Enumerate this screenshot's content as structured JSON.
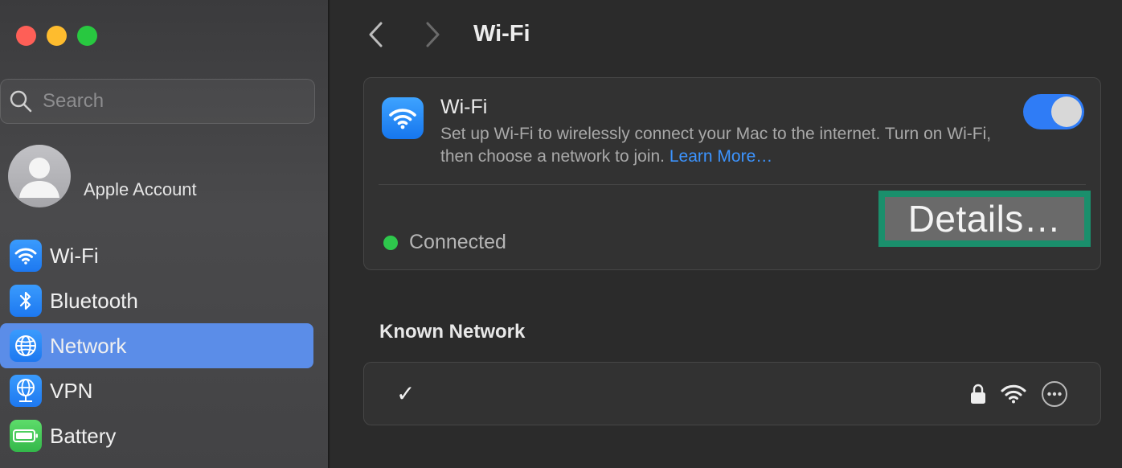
{
  "window": {
    "controls": [
      "close",
      "minimize",
      "zoom"
    ]
  },
  "sidebar": {
    "search": {
      "placeholder": "Search",
      "value": ""
    },
    "account": {
      "label": "Apple Account"
    },
    "items": [
      {
        "label": "Wi-Fi",
        "icon": "wifi-icon",
        "color": "#1d78f0",
        "active": false
      },
      {
        "label": "Bluetooth",
        "icon": "bluetooth-icon",
        "color": "#1d78f0",
        "active": false
      },
      {
        "label": "Network",
        "icon": "globe-icon",
        "color": "#1d78f0",
        "active": true
      },
      {
        "label": "VPN",
        "icon": "vpn-globe-icon",
        "color": "#1d78f0",
        "active": false
      },
      {
        "label": "Battery",
        "icon": "battery-icon",
        "color": "#33b84a",
        "active": false
      }
    ]
  },
  "main": {
    "title": "Wi-Fi",
    "wifi_card": {
      "title": "Wi-Fi",
      "description": "Set up Wi-Fi to wirelessly connect your Mac to the internet. Turn on Wi-Fi, then choose a network to join.",
      "learn_more": "Learn More…",
      "toggle_on": true,
      "status": "Connected",
      "status_color": "#2ec84c",
      "details_label": "Details…",
      "highlight_color": "#1a8f6c"
    },
    "known_network": {
      "section_title": "Known Network",
      "check": "✓",
      "icons": [
        "lock-icon",
        "wifi-signal-icon",
        "more-icon"
      ]
    }
  },
  "colors": {
    "accent": "#2f7cf6",
    "sidebar_selected": "#5b8de8"
  }
}
